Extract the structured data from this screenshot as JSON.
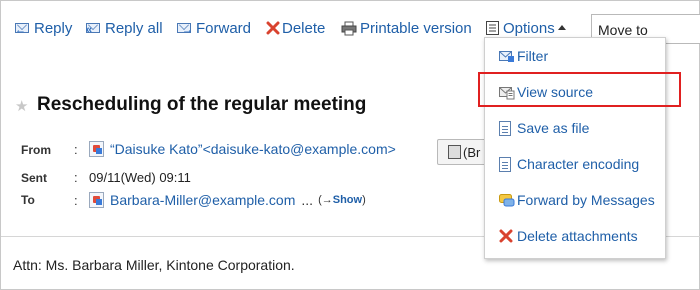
{
  "toolbar": {
    "reply": "Reply",
    "reply_all": "Reply all",
    "forward": "Forward",
    "delete": "Delete",
    "printable": "Printable version",
    "options": "Options",
    "move_to": "Move to"
  },
  "message": {
    "subject": "Rescheduling of the regular meeting",
    "from_label": "From",
    "from_value": "“Daisuke Kato”<daisuke-kato@example.com>",
    "from_button": "(Br",
    "sent_label": "Sent",
    "sent_value": "09/11(Wed) 09:11",
    "to_label": "To",
    "to_value": "Barbara-Miller@example.com",
    "to_more": "...",
    "show_prefix": "(→",
    "show_label": "Show",
    "show_suffix": ")",
    "body": "Attn: Ms. Barbara Miller, Kintone Corporation."
  },
  "options_menu": {
    "items": [
      "Filter",
      "View source",
      "Save as file",
      "Character encoding",
      "Forward by Messages",
      "Delete attachments"
    ],
    "highlighted": "View source"
  },
  "colors": {
    "link": "#1f5fa8",
    "highlight_border": "#e02020",
    "delete_icon": "#d9432f"
  },
  "icons": {
    "reply": "reply-envelope-icon",
    "reply_all": "reply-all-envelope-icon",
    "forward": "forward-envelope-icon",
    "delete": "red-x-icon",
    "printable": "printer-icon",
    "options": "options-list-icon"
  }
}
